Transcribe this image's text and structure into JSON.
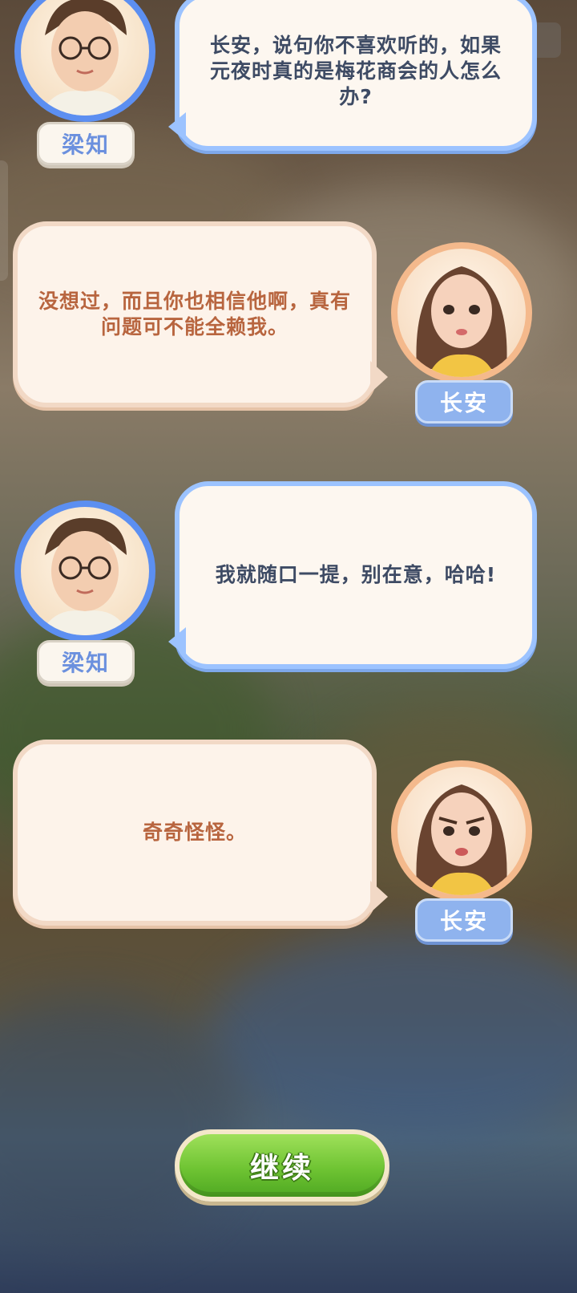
{
  "dialogue": [
    {
      "speaker": "梁知",
      "side": "left",
      "theme": "blue",
      "text": "长安，说句你不喜欢听的，如果元夜时真的是梅花商会的人怎么办?",
      "avatar_icon": "boy-with-glasses-icon"
    },
    {
      "speaker": "长安",
      "side": "right",
      "theme": "peach",
      "text": "没想过，而且你也相信他啊，真有问题可不能全赖我。",
      "avatar_icon": "girl-long-hair-icon"
    },
    {
      "speaker": "梁知",
      "side": "left",
      "theme": "blue",
      "text": "我就随口一提，别在意，哈哈!",
      "avatar_icon": "boy-with-glasses-icon"
    },
    {
      "speaker": "长安",
      "side": "right",
      "theme": "peach",
      "text": "奇奇怪怪。",
      "avatar_icon": "girl-frowning-icon"
    }
  ],
  "continue_button": {
    "label": "继续"
  },
  "colors": {
    "blue_border": "#9cc3ff",
    "peach_border": "#f2d9c6",
    "blue_text": "#3e4b64",
    "peach_text": "#b8653f",
    "button_green": "#6fc433"
  }
}
